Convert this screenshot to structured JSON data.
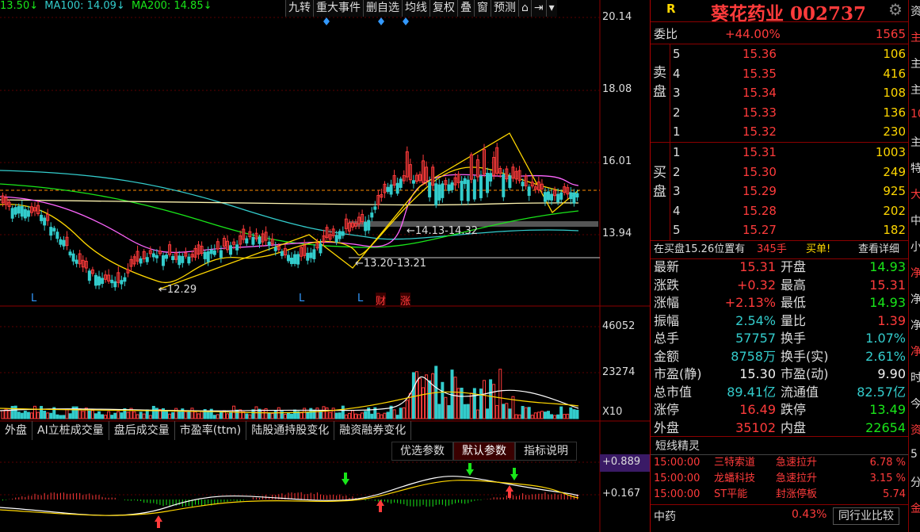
{
  "ma_legend": [
    {
      "label": "13.50↓",
      "color": "#19e619"
    },
    {
      "label": "MA100: 14.09↓",
      "color": "#33cccc"
    },
    {
      "label": "MA200: 14.85↓",
      "color": "#19e619"
    }
  ],
  "toolbar": [
    "九转",
    "重大事件",
    "删自选",
    "均线",
    "复权",
    "叠",
    "窗",
    "预测"
  ],
  "price_axis": [
    "20.14",
    "18.08",
    "16.01",
    "13.94"
  ],
  "volume_axis": [
    "46052",
    "23274",
    "X10"
  ],
  "indicator_axis": [
    "+0.889",
    "+0.167"
  ],
  "annotations": {
    "low": "12.29",
    "range1": "14.13-14.32",
    "range2": "13.20-13.21",
    "markers": [
      "L",
      "L",
      "L",
      "财",
      "涨"
    ]
  },
  "bottom_tabs": [
    "外盘",
    "AI立桩成交量",
    "盘后成交量",
    "市盈率(ttm)",
    "陆股通持股变化",
    "融资融券变化"
  ],
  "param_tabs": [
    "优选参数",
    "默认参数",
    "指标说明"
  ],
  "header": {
    "r_label": "R",
    "title": "葵花药业 002737"
  },
  "weibi": {
    "label": "委比",
    "pct": "+44.00%",
    "diff": "1565"
  },
  "sell_label": "卖盘",
  "buy_label": "买盘",
  "sell": [
    {
      "lvl": "5",
      "price": "15.36",
      "vol": "106"
    },
    {
      "lvl": "4",
      "price": "15.35",
      "vol": "416"
    },
    {
      "lvl": "3",
      "price": "15.34",
      "vol": "108"
    },
    {
      "lvl": "2",
      "price": "15.33",
      "vol": "136"
    },
    {
      "lvl": "1",
      "price": "15.32",
      "vol": "230"
    }
  ],
  "buy": [
    {
      "lvl": "1",
      "price": "15.31",
      "vol": "1003"
    },
    {
      "lvl": "2",
      "price": "15.30",
      "vol": "249"
    },
    {
      "lvl": "3",
      "price": "15.29",
      "vol": "925"
    },
    {
      "lvl": "4",
      "price": "15.28",
      "vol": "202"
    },
    {
      "lvl": "5",
      "price": "15.27",
      "vol": "182"
    }
  ],
  "notice": {
    "text": "在买盘15.26位置有",
    "vol": "345手",
    "tag": "买单!",
    "detail": "查看详细"
  },
  "stats": [
    {
      "l1": "最新",
      "v1": "15.31",
      "c1": "#ff3b3b",
      "l2": "开盘",
      "v2": "14.93",
      "c2": "#19e619"
    },
    {
      "l1": "涨跌",
      "v1": "+0.32",
      "c1": "#ff3b3b",
      "l2": "最高",
      "v2": "15.31",
      "c2": "#ff3b3b"
    },
    {
      "l1": "涨幅",
      "v1": "+2.13%",
      "c1": "#ff3b3b",
      "l2": "最低",
      "v2": "14.93",
      "c2": "#19e619"
    },
    {
      "l1": "振幅",
      "v1": "2.54%",
      "c1": "#33cccc",
      "l2": "量比",
      "v2": "1.39",
      "c2": "#ff3b3b"
    },
    {
      "l1": "总手",
      "v1": "57757",
      "c1": "#33cccc",
      "l2": "换手",
      "v2": "1.07%",
      "c2": "#33cccc"
    },
    {
      "l1": "金额",
      "v1": "8758万",
      "c1": "#33cccc",
      "l2": "换手(实)",
      "v2": "2.61%",
      "c2": "#33cccc"
    },
    {
      "l1": "市盈(静)",
      "v1": "15.30",
      "c1": "#f2f2f2",
      "l2": "市盈(动)",
      "v2": "9.90",
      "c2": "#f2f2f2"
    },
    {
      "l1": "总市值",
      "v1": "89.41亿",
      "c1": "#33cccc",
      "l2": "流通值",
      "v2": "82.57亿",
      "c2": "#33cccc"
    },
    {
      "l1": "涨停",
      "v1": "16.49",
      "c1": "#ff3b3b",
      "l2": "跌停",
      "v2": "13.49",
      "c2": "#19e619"
    },
    {
      "l1": "外盘",
      "v1": "35102",
      "c1": "#ff3b3b",
      "l2": "内盘",
      "v2": "22654",
      "c2": "#19e619"
    }
  ],
  "short_term": {
    "title": "短线精灵",
    "rows": [
      {
        "time": "15:00:00",
        "name": "三特索道",
        "event": "急速拉升",
        "val": "6.78 %"
      },
      {
        "time": "15:00:00",
        "name": "龙蟠科技",
        "event": "急速拉升",
        "val": "3.15 %"
      },
      {
        "time": "15:00:00",
        "name": "ST平能",
        "event": "封涨停板",
        "val": "5.74"
      }
    ]
  },
  "footer": {
    "sector": "中药",
    "pct": "0.43%",
    "btn": "同行业比较"
  },
  "edge_chars": [
    "资",
    "主",
    "主",
    "主",
    "10",
    "主",
    "特",
    "大",
    "中",
    "小",
    "净",
    "净",
    "净",
    "净",
    "时",
    "今",
    "资",
    "5",
    "分",
    "金"
  ]
}
